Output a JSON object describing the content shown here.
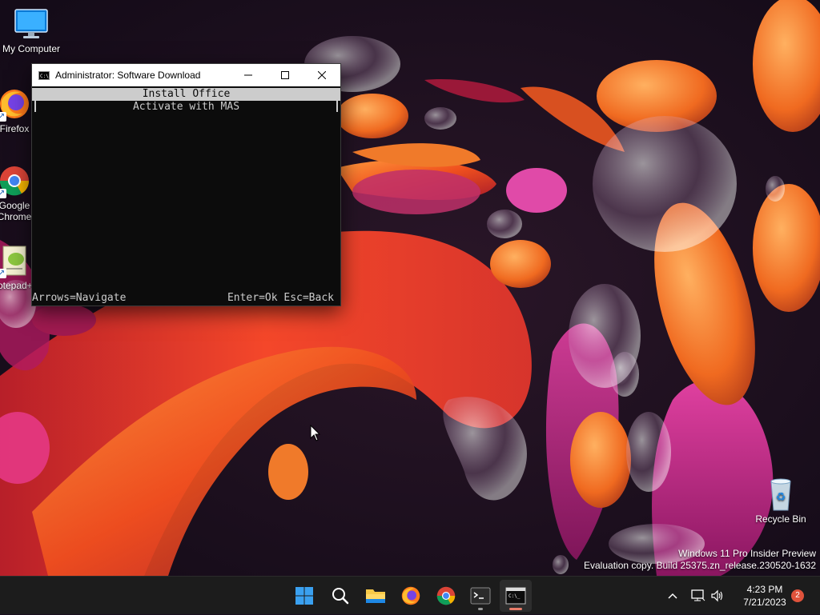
{
  "desktop": {
    "icons": [
      {
        "label": "My Computer"
      },
      {
        "label": "Firefox"
      },
      {
        "label": "Google Chrome"
      },
      {
        "label": "Notepad++"
      },
      {
        "label": "Recycle Bin"
      }
    ]
  },
  "console": {
    "title": "Administrator:  Software Download",
    "menu_items": [
      "Install Office",
      "Activate with MAS"
    ],
    "selected_index": 0,
    "footer_left": "Arrows=Navigate",
    "footer_right": "Enter=Ok Esc=Back"
  },
  "watermark": {
    "line1": "Windows 11 Pro Insider Preview",
    "line2": "Evaluation copy. Build 25375.zn_release.230520-1632"
  },
  "taskbar": {
    "apps": [
      "start-icon",
      "search-icon",
      "file-explorer-icon",
      "firefox-icon",
      "chrome-icon",
      "terminal-icon",
      "console-app-icon"
    ],
    "clock_time": "4:23 PM",
    "clock_date": "7/21/2023",
    "notification_count": "2"
  },
  "colors": {
    "console_bg": "#0c0c0c",
    "console_fg": "#cccccc",
    "taskbar_bg": "#1c1c1c",
    "badge": "#e0533c"
  }
}
